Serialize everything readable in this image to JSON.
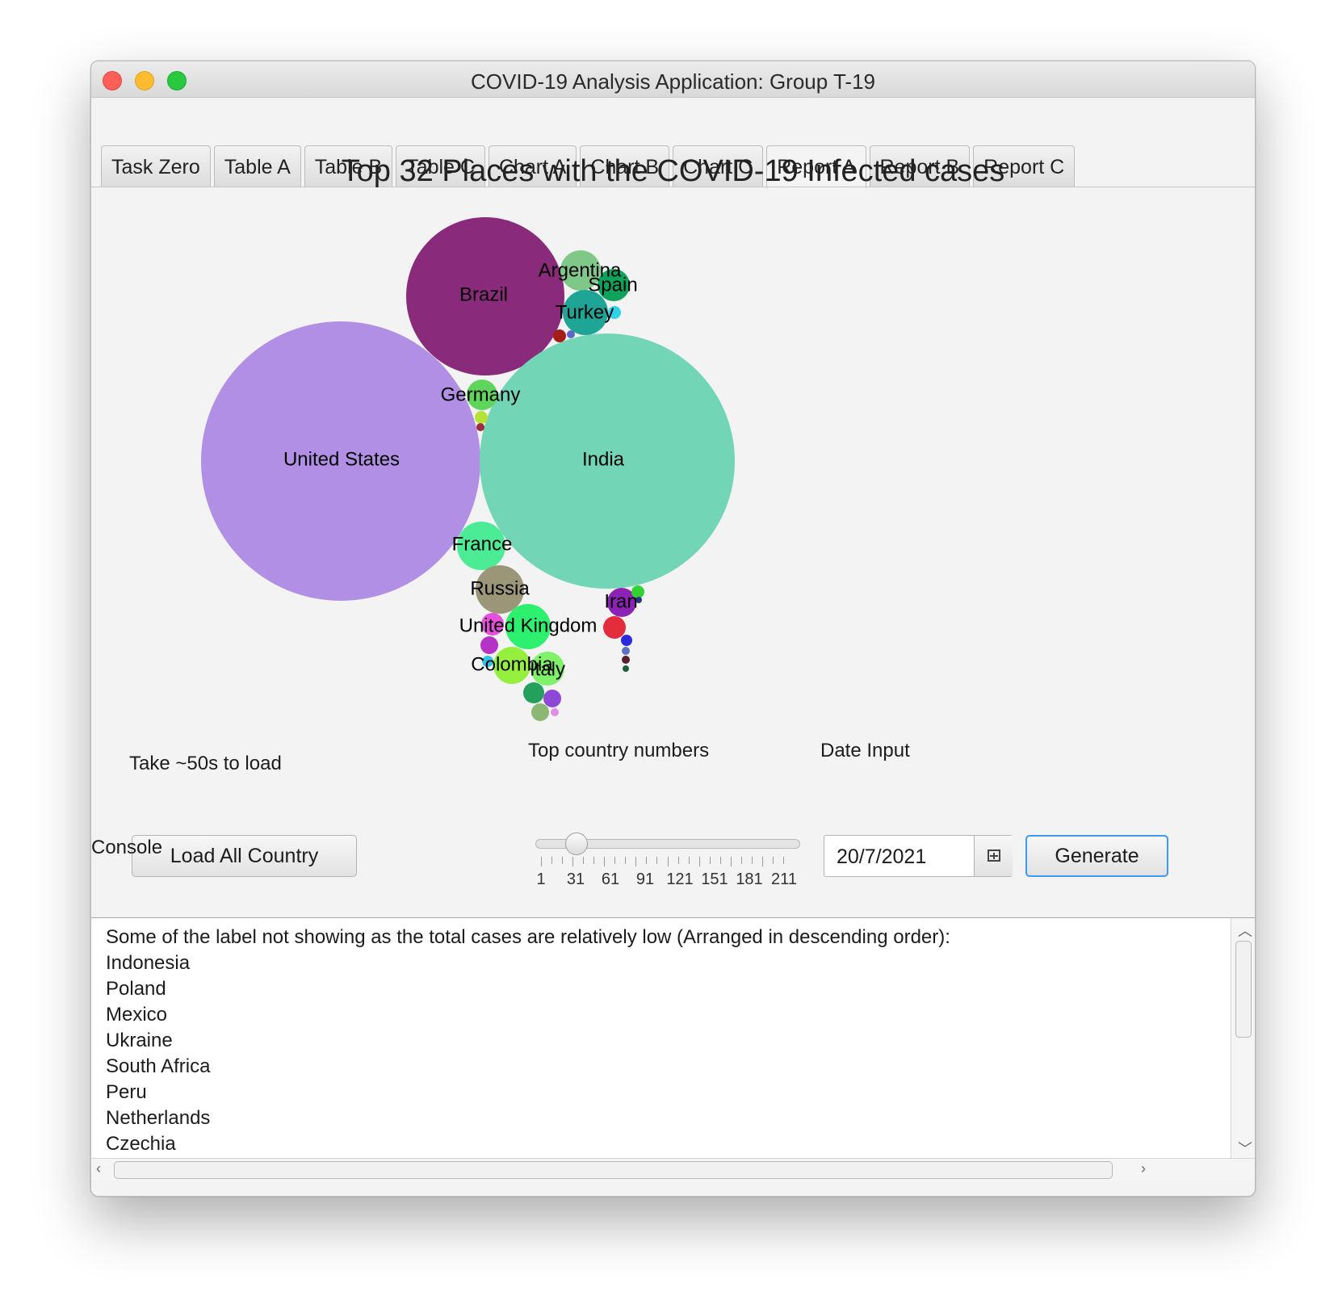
{
  "window": {
    "title": "COVID-19 Analysis Application: Group T-19"
  },
  "tabs": [
    {
      "label": "Task Zero"
    },
    {
      "label": "Table A"
    },
    {
      "label": "Table B"
    },
    {
      "label": "Table C"
    },
    {
      "label": "Chart A"
    },
    {
      "label": "Chart B"
    },
    {
      "label": "Chart C"
    },
    {
      "label": "Report A",
      "active": true
    },
    {
      "label": "Report B"
    },
    {
      "label": "Report C"
    }
  ],
  "chart_data": {
    "type": "bubble",
    "title": "Top 32 Places with the COVID-19 Infected cases",
    "labeled": [
      {
        "name": "United States",
        "color": "#b18fe5"
      },
      {
        "name": "India",
        "color": "#72d5b5"
      },
      {
        "name": "Brazil",
        "color": "#8a2a7a"
      },
      {
        "name": "Argentina",
        "color": "#80c887"
      },
      {
        "name": "Spain",
        "color": "#0ea25c"
      },
      {
        "name": "Turkey",
        "color": "#1fa596"
      },
      {
        "name": "Germany",
        "color": "#5fd65b"
      },
      {
        "name": "France",
        "color": "#4ceb95"
      },
      {
        "name": "Russia",
        "color": "#9b9678"
      },
      {
        "name": "Iran",
        "color": "#8b22b5"
      },
      {
        "name": "United Kingdom",
        "color": "#2df06e"
      },
      {
        "name": "Colombia",
        "color": "#94ef3f"
      },
      {
        "name": "Italy",
        "color": "#7ff26a"
      }
    ]
  },
  "controls": {
    "load_hint": "Take ~50s to load",
    "load_button": "Load All Country",
    "slider_label": "Top country numbers",
    "slider_ticks": [
      "1",
      "31",
      "61",
      "91",
      "121",
      "151",
      "181",
      "211"
    ],
    "slider_value": 32,
    "slider_min": 1,
    "slider_max": 230,
    "date_label": "Date Input",
    "date_value": "20/7/2021",
    "generate_button": "Generate",
    "calendar_icon": "calendar-icon"
  },
  "console": {
    "label": "Console",
    "lines": [
      "Some of the label not showing as the total cases are relatively low (Arranged in descending order):",
      "Indonesia",
      "Poland",
      "Mexico",
      "Ukraine",
      "South Africa",
      "Peru",
      "Netherlands",
      "Czechia"
    ]
  }
}
